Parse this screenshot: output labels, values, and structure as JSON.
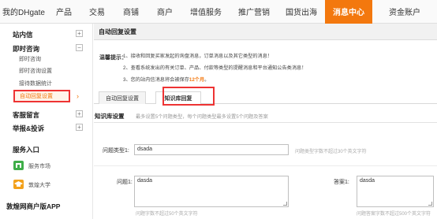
{
  "topnav": {
    "items": [
      {
        "label": "我的DHgate"
      },
      {
        "label": "产品"
      },
      {
        "label": "交易"
      },
      {
        "label": "商铺"
      },
      {
        "label": "商户"
      },
      {
        "label": "增值服务"
      },
      {
        "label": "推广营销"
      },
      {
        "label": "国货出海"
      },
      {
        "label": "消息中心"
      },
      {
        "label": "资金账户"
      }
    ],
    "active_label": "消息中心",
    "accent_color": "#f3780e"
  },
  "sidebar": {
    "station_letter": "站内信",
    "instant_inquiry": "即时咨询",
    "sub_items": [
      "即时咨询",
      "即时咨询设置",
      "接待数据统计",
      "自动回复设置"
    ],
    "active_item": "自动回复设置",
    "customer_message": "客服留言",
    "report_complaint": "举报&投诉",
    "service_entry": "服务入口",
    "service_market": "服务市场",
    "dunhuang_university": "敦煌大学",
    "mobile_app": "敦煌网商户版APP"
  },
  "main": {
    "panel_title": "自动回复设置",
    "tip_label": "温馨提示：",
    "tips": [
      "1、接收和回复买家发起的询盘消息，订单消息以及其它类型的消息！",
      "2、查看系统发出的有关订单、产品、付款等类型的提醒消息和平台通知公告类消息！"
    ],
    "tip3_prefix": "3、您的站内信消息将会被保存",
    "tip3_highlight": "12个月",
    "tip3_suffix": "。",
    "tabs": [
      "自动回复设置",
      "知识库回复"
    ],
    "active_tab": "知识库回复",
    "kb_title": "知识库设置",
    "kb_desc": "最多设置5个问题类型，每个问题类型最多设置5个问题及答案",
    "question_type_label": "问题类型1:",
    "question_type_value": "dsada",
    "question_type_hint": "问题类型字数不超过30个英文字符",
    "question_label": "问题1:",
    "question_value": "dasda",
    "question_hint": "问题字数不超过50个英文字符",
    "answer_label": "答案1:",
    "answer_value": "dasda",
    "answer_hint": "问题答案字数不超过500个英文字符"
  }
}
